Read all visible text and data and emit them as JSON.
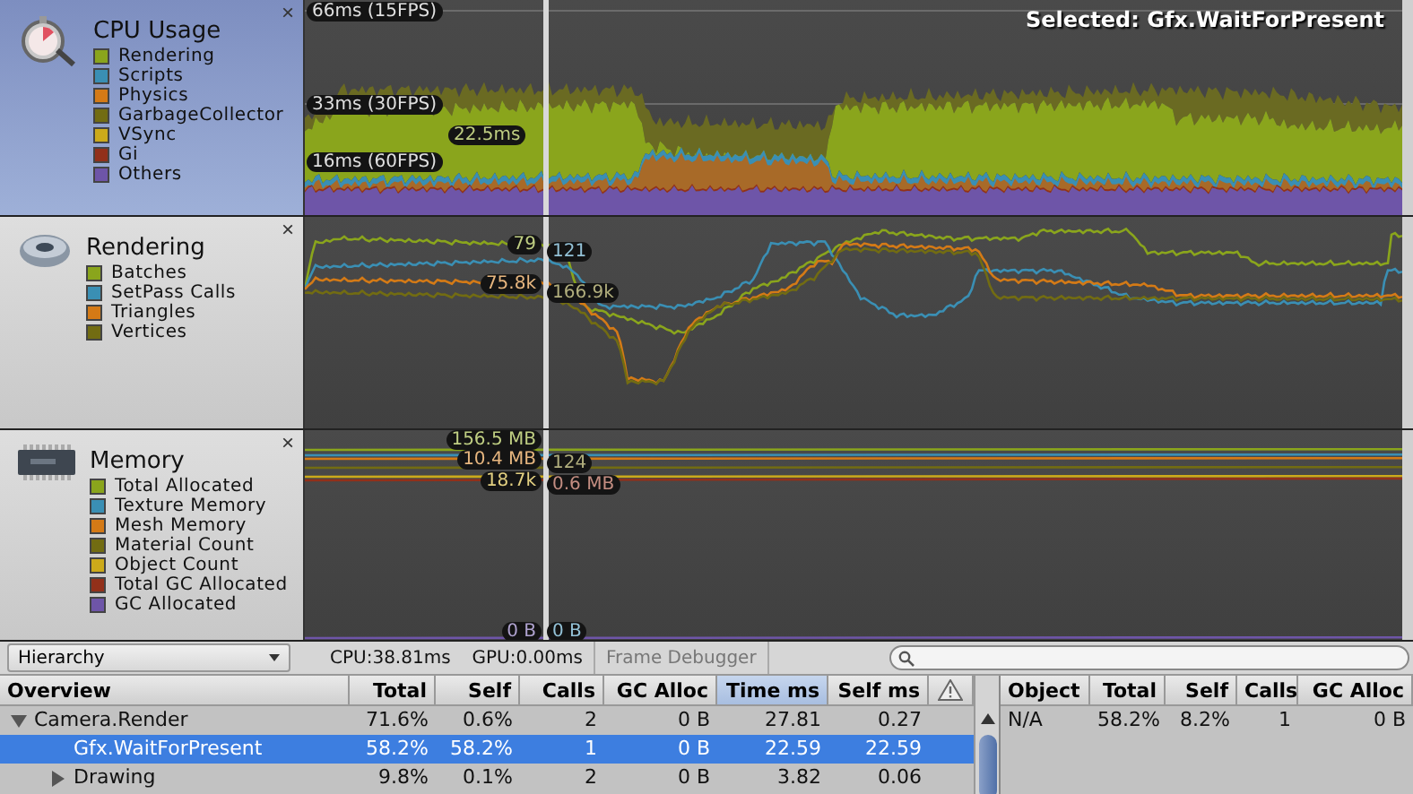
{
  "panels": [
    {
      "kind": "cpu",
      "title": "CPU Usage",
      "selected": true,
      "close": "×",
      "legend": [
        {
          "label": "Rendering",
          "color": "#8aa51c"
        },
        {
          "label": "Scripts",
          "color": "#3a8fb4"
        },
        {
          "label": "Physics",
          "color": "#d47a16"
        },
        {
          "label": "GarbageCollector",
          "color": "#726c12"
        },
        {
          "label": "VSync",
          "color": "#ccaa1a"
        },
        {
          "label": "Gi",
          "color": "#92301a"
        },
        {
          "label": "Others",
          "color": "#6e55a8"
        }
      ],
      "chart_labels": [
        "66ms (15FPS)",
        "Selected: Gfx.WaitForPresent",
        "33ms (30FPS)",
        "22.5ms",
        "16ms (60FPS)"
      ]
    },
    {
      "kind": "rendering",
      "title": "Rendering",
      "selected": false,
      "close": "×",
      "legend": [
        {
          "label": "Batches",
          "color": "#8aa51c"
        },
        {
          "label": "SetPass Calls",
          "color": "#3a8fb4"
        },
        {
          "label": "Triangles",
          "color": "#d47a16"
        },
        {
          "label": "Vertices",
          "color": "#726c12"
        }
      ],
      "chart_labels": [
        "79",
        "121",
        "75.8k",
        "166.9k"
      ]
    },
    {
      "kind": "memory",
      "title": "Memory",
      "selected": false,
      "close": "×",
      "legend": [
        {
          "label": "Total Allocated",
          "color": "#8aa51c"
        },
        {
          "label": "Texture Memory",
          "color": "#3a8fb4"
        },
        {
          "label": "Mesh Memory",
          "color": "#d47a16"
        },
        {
          "label": "Material Count",
          "color": "#726c12"
        },
        {
          "label": "Object Count",
          "color": "#ccaa1a"
        },
        {
          "label": "Total GC Allocated",
          "color": "#92301a"
        },
        {
          "label": "GC Allocated",
          "color": "#6e55a8"
        }
      ],
      "chart_labels": [
        "156.5 MB",
        "10.4 MB",
        "124",
        "18.7k",
        "0.6 MB",
        "0 B",
        "0 B"
      ]
    }
  ],
  "toolbar": {
    "view": "Hierarchy",
    "cpu": "CPU:38.81ms",
    "gpu": "GPU:0.00ms",
    "frame_debugger": "Frame Debugger"
  },
  "hierarchy": {
    "columns": [
      {
        "label": "Overview",
        "selected": false
      },
      {
        "label": "Total",
        "selected": false
      },
      {
        "label": "Self",
        "selected": false
      },
      {
        "label": "Calls",
        "selected": false
      },
      {
        "label": "GC Alloc",
        "selected": false
      },
      {
        "label": "Time ms",
        "selected": true
      },
      {
        "label": "Self ms",
        "selected": false
      }
    ],
    "rows": [
      {
        "name": "Camera.Render",
        "total": "71.6%",
        "self": "0.6%",
        "calls": "2",
        "gc_alloc": "0 B",
        "time_ms": "27.81",
        "self_ms": "0.27",
        "selected": false,
        "expanded": true,
        "children": [
          {
            "name": "Gfx.WaitForPresent",
            "total": "58.2%",
            "self": "58.2%",
            "calls": "1",
            "gc_alloc": "0 B",
            "time_ms": "22.59",
            "self_ms": "22.59",
            "selected": true
          },
          {
            "name": "Drawing",
            "total": "9.8%",
            "self": "0.1%",
            "calls": "2",
            "gc_alloc": "0 B",
            "time_ms": "3.82",
            "self_ms": "0.06",
            "selected": false,
            "expanded": false
          }
        ]
      }
    ]
  },
  "objects": {
    "columns": [
      "Object",
      "Total",
      "Self",
      "Calls",
      "GC Alloc"
    ],
    "rows": [
      {
        "object": "N/A",
        "total": "58.2%",
        "self": "8.2%",
        "calls": "1",
        "gc_alloc": "0 B"
      }
    ]
  }
}
